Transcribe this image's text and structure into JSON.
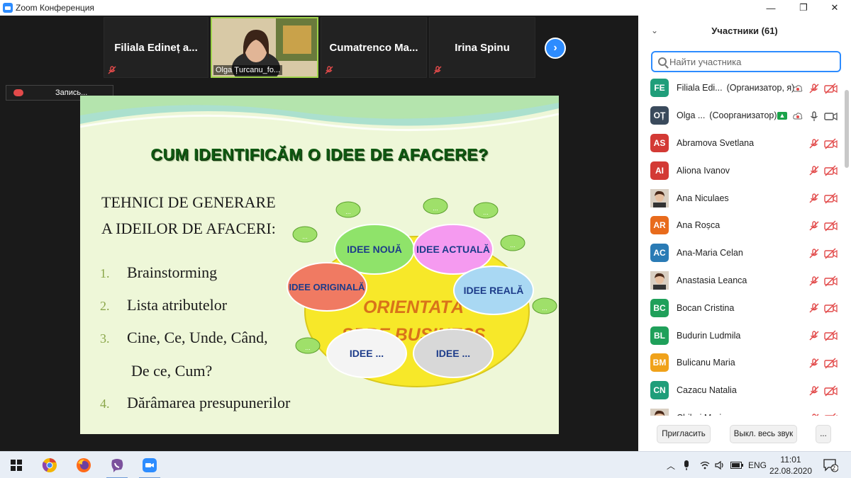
{
  "window": {
    "title": "Zoom Конференция",
    "controls": [
      "—",
      "❐",
      "✕"
    ]
  },
  "video": {
    "thumbnails": [
      {
        "name": "Filiala  Edineț  a..."
      },
      {
        "name": "Olga Țurcanu_fo..."
      },
      {
        "name": "Cumatrenco   Ma..."
      },
      {
        "name": "Irina Spinu"
      }
    ],
    "recording_label": "Запись..."
  },
  "slide": {
    "title": "CUM IDENTIFICĂM O IDEE DE AFACERE?",
    "subtitle_line1": "TEHNICI DE GENERARE",
    "subtitle_line2": "A IDEILOR DE AFACERI:",
    "items": [
      {
        "num": "1.",
        "text": "Brainstorming"
      },
      {
        "num": "2.",
        "text": "Lista atributelor"
      },
      {
        "num": "3.",
        "text": "Cine, Ce, Unde, Când,"
      },
      {
        "num": "",
        "text": "De ce, Cum?"
      },
      {
        "num": "4.",
        "text": "Dărâmarea presupunerilor"
      }
    ],
    "diagram": {
      "center_line1": "ORIENTATĂ",
      "center_line2": "SPRE BUSINESS",
      "bubbles": [
        "IDEE NOUĂ",
        "IDEE ACTUALĂ",
        "IDEE ORIGINALĂ",
        "IDEE REALĂ",
        "IDEE ...",
        "IDEE ..."
      ],
      "small_bubble_text": "..."
    }
  },
  "participants_panel": {
    "title": "Участники (61)",
    "search_placeholder": "Найти участника",
    "participants": [
      {
        "initials": "FE",
        "color": "#1f9e7a",
        "name": "Filiala Edi...",
        "role": "(Организатор, я)",
        "rec": true,
        "mic_muted": true,
        "cam_off": true
      },
      {
        "initials": "OȚ",
        "color": "#3a4a5c",
        "name": "Olga ...",
        "role": "(Соорганизатор)",
        "share": true,
        "rec": true,
        "mic_muted": false,
        "cam_off": false
      },
      {
        "initials": "AS",
        "color": "#d33a35",
        "name": "Abramova Svetlana",
        "role": "",
        "mic_muted": true,
        "cam_off": true
      },
      {
        "initials": "AI",
        "color": "#d33a35",
        "name": "Aliona Ivanov",
        "role": "",
        "mic_muted": true,
        "cam_off": true
      },
      {
        "initials": "",
        "color": "photo",
        "name": "Ana Niculaes",
        "role": "",
        "mic_muted": true,
        "cam_off": true
      },
      {
        "initials": "AR",
        "color": "#e86b1c",
        "name": "Ana Roșca",
        "role": "",
        "mic_muted": true,
        "cam_off": true
      },
      {
        "initials": "AC",
        "color": "#2a7bb5",
        "name": "Ana-Maria Celan",
        "role": "",
        "mic_muted": true,
        "cam_off": true
      },
      {
        "initials": "",
        "color": "photo",
        "name": "Anastasia Leanca",
        "role": "",
        "mic_muted": true,
        "cam_off": true
      },
      {
        "initials": "BC",
        "color": "#1fa05a",
        "name": "Bocan Cristina",
        "role": "",
        "mic_muted": true,
        "cam_off": true
      },
      {
        "initials": "BL",
        "color": "#1fa05a",
        "name": "Budurin Ludmila",
        "role": "",
        "mic_muted": true,
        "cam_off": true
      },
      {
        "initials": "BM",
        "color": "#f0a21a",
        "name": "Bulicanu Maria",
        "role": "",
        "mic_muted": true,
        "cam_off": true
      },
      {
        "initials": "CN",
        "color": "#1f9e7a",
        "name": "Cazacu Natalia",
        "role": "",
        "mic_muted": true,
        "cam_off": true
      },
      {
        "initials": "",
        "color": "photo",
        "name": "Chilari Maria",
        "role": "",
        "mic_muted": true,
        "cam_off": true
      }
    ],
    "invite_button": "Пригласить",
    "mute_all_button": "Выкл. весь звук",
    "more_button": "..."
  },
  "taskbar": {
    "apps": [
      "windows-start",
      "chrome",
      "firefox",
      "viber",
      "zoom"
    ],
    "language": "ENG",
    "time": "11:01",
    "date": "22.08.2020",
    "notification_count": "2"
  }
}
